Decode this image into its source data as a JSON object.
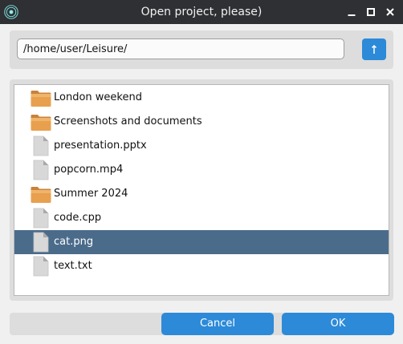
{
  "window": {
    "title": "Open project, please)"
  },
  "path": {
    "value": "/home/user/Leisure/"
  },
  "files": [
    {
      "name": "London weekend",
      "type": "folder"
    },
    {
      "name": "Screenshots and documents",
      "type": "folder"
    },
    {
      "name": "presentation.pptx",
      "type": "file"
    },
    {
      "name": "popcorn.mp4",
      "type": "file"
    },
    {
      "name": "Summer 2024",
      "type": "folder"
    },
    {
      "name": "code.cpp",
      "type": "file"
    },
    {
      "name": "cat.png",
      "type": "file",
      "selected": true
    },
    {
      "name": "text.txt",
      "type": "file"
    }
  ],
  "buttons": {
    "cancel": "Cancel",
    "ok": "OK"
  },
  "colors": {
    "titlebar": "#2e3033",
    "accent": "#2c8ad8",
    "selection": "#4b6b8b",
    "folder": "#e8a04e",
    "file": "#d8d8d8"
  },
  "icons": {
    "app": "app-logo-icon",
    "minimize": "minimize-icon",
    "maximize": "maximize-icon",
    "close": "close-icon",
    "up": "arrow-up-icon",
    "folder": "folder-icon",
    "file": "file-icon"
  }
}
